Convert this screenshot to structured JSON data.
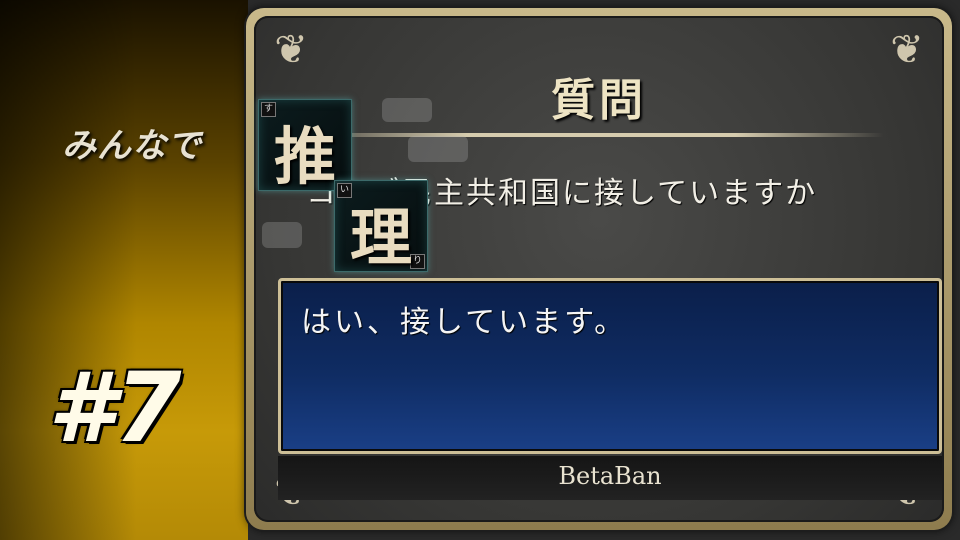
{
  "overlay": {
    "series_title": "みんなで",
    "episode_number": "#7",
    "kanji_tiles": [
      {
        "kanji": "推",
        "furigana": "す"
      },
      {
        "kanji": "理",
        "furigana": "い",
        "furigana2": "り"
      }
    ]
  },
  "dialog": {
    "title": "質問",
    "question": "コンゴ民主共和国に接していますか",
    "answer": "はい、接しています。",
    "name": "BetaBan"
  },
  "colors": {
    "gold_band": "#c79a08",
    "frame": "#c9b98a",
    "answer_bg": "#0f2c63",
    "text": "#f2efe6"
  }
}
